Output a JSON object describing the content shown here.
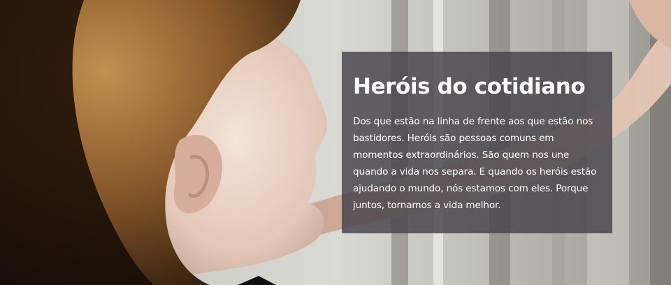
{
  "hero": {
    "title": "Heróis do cotidiano",
    "description": "Dos que estão na linha de frente aos que estão nos bastidores. Heróis são pessoas comuns em momentos extraordinários. São quem nos une quando a vida nos separa. E quando os heróis estão ajudando o mundo, nós estamos com eles. Porque juntos, tornamos a vida melhor."
  },
  "colors": {
    "card_background": "#46424a",
    "text": "#ffffff"
  }
}
